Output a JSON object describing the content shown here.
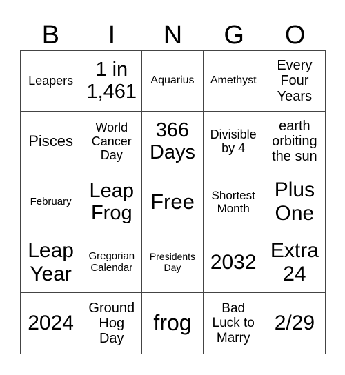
{
  "header": {
    "letters": [
      "B",
      "I",
      "N",
      "G",
      "O"
    ]
  },
  "card": {
    "cells": [
      "Leapers",
      "1 in 1,461",
      "Aquarius",
      "Amethyst",
      "Every Four Years",
      "Pisces",
      "World Cancer Day",
      "366 Days",
      "Divisible by 4",
      "earth orbiting the sun",
      "February",
      "Leap Frog",
      "Free",
      "Shortest Month",
      "Plus One",
      "Leap Year",
      "Gregorian Calendar",
      "Presidents Day",
      "2032",
      "Extra 24",
      "2024",
      "Ground Hog Day",
      "frog",
      "Bad Luck to Marry",
      "2/29"
    ]
  }
}
